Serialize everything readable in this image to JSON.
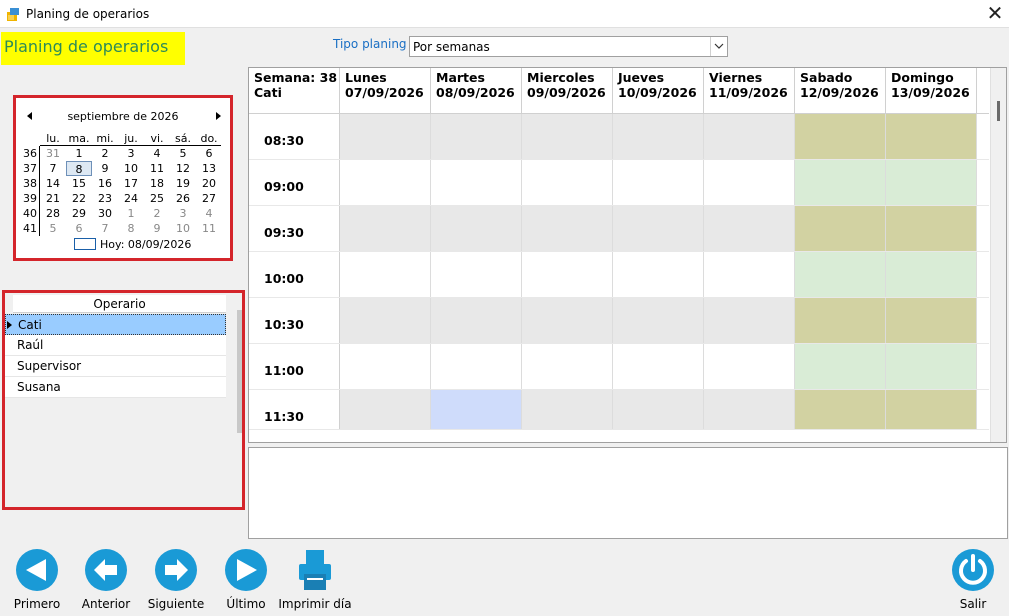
{
  "window": {
    "title": "Planing de operarios",
    "close": "✕"
  },
  "form_title": "Planing de operarios",
  "tipo_planing": {
    "label": "Tipo planing",
    "value": "Por semanas"
  },
  "calendar": {
    "month_label": "septiembre de 2026",
    "weekdays": [
      "lu.",
      "ma.",
      "mi.",
      "ju.",
      "vi.",
      "sá.",
      "do."
    ],
    "weeks": [
      {
        "wk": "36",
        "days": [
          "31",
          "1",
          "2",
          "3",
          "4",
          "5",
          "6"
        ]
      },
      {
        "wk": "37",
        "days": [
          "7",
          "8",
          "9",
          "10",
          "11",
          "12",
          "13"
        ]
      },
      {
        "wk": "38",
        "days": [
          "14",
          "15",
          "16",
          "17",
          "18",
          "19",
          "20"
        ]
      },
      {
        "wk": "39",
        "days": [
          "21",
          "22",
          "23",
          "24",
          "25",
          "26",
          "27"
        ]
      },
      {
        "wk": "40",
        "days": [
          "28",
          "29",
          "30",
          "1",
          "2",
          "3",
          "4"
        ]
      },
      {
        "wk": "41",
        "days": [
          "5",
          "6",
          "7",
          "8",
          "9",
          "10",
          "11"
        ]
      }
    ],
    "today_label": "Hoy: 08/09/2026"
  },
  "operators": {
    "header": "Operario",
    "items": [
      "Cati",
      "Raúl",
      "Supervisor",
      "Susana"
    ],
    "selected": "Cati"
  },
  "schedule": {
    "corner": [
      "Semana: 38",
      "Cati"
    ],
    "days": [
      {
        "name": "Lunes",
        "date": "07/09/2026"
      },
      {
        "name": "Martes",
        "date": "08/09/2026"
      },
      {
        "name": "Miercoles",
        "date": "09/09/2026"
      },
      {
        "name": "Jueves",
        "date": "10/09/2026"
      },
      {
        "name": "Viernes",
        "date": "11/09/2026"
      },
      {
        "name": "Sabado",
        "date": "12/09/2026"
      },
      {
        "name": "Domingo",
        "date": "13/09/2026"
      }
    ],
    "times": [
      "08:30",
      "09:00",
      "09:30",
      "10:00",
      "10:30",
      "11:00",
      "11:30"
    ],
    "colors": {
      "weekday_half": "#e8e8e8",
      "weekday_hour": "#ffffff",
      "weekend_half": "#d2d2a2",
      "weekend_hour": "#d9ecd6",
      "highlight": "#cfdcfb"
    }
  },
  "toolbar": {
    "primero": "Primero",
    "anterior": "Anterior",
    "siguiente": "Siguiente",
    "ultimo": "Último",
    "imprimir": "Imprimir día",
    "salir": "Salir"
  }
}
